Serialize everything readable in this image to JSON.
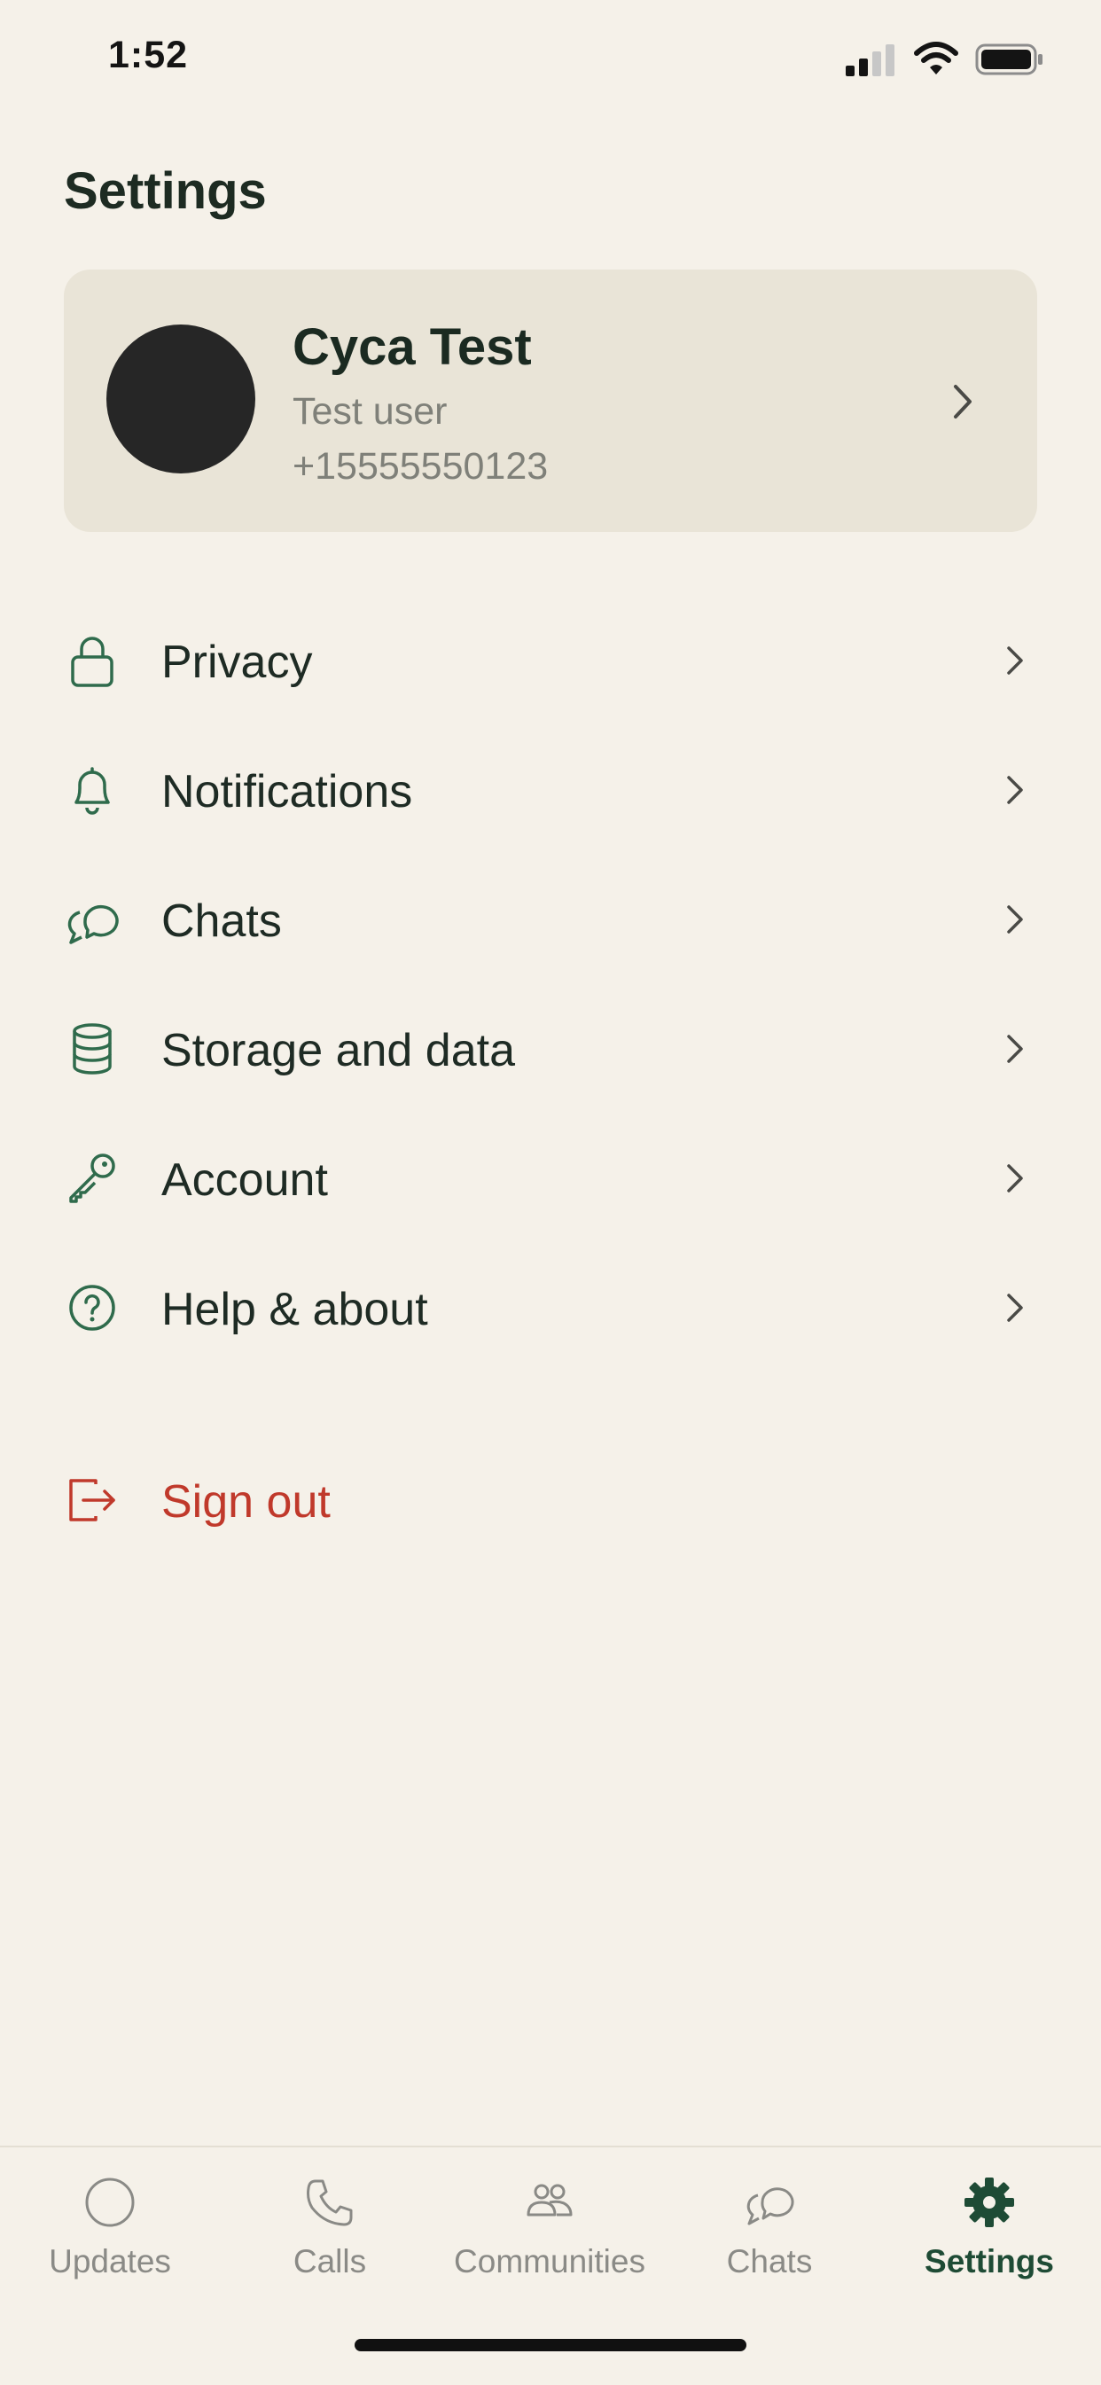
{
  "status_bar": {
    "time": "1:52"
  },
  "header": {
    "title": "Settings"
  },
  "profile": {
    "name": "Cyca Test",
    "status": "Test user",
    "phone": "+15555550123"
  },
  "settings_list": {
    "items": [
      {
        "label": "Privacy",
        "icon": "lock-icon"
      },
      {
        "label": "Notifications",
        "icon": "bell-icon"
      },
      {
        "label": "Chats",
        "icon": "chat-bubbles-icon"
      },
      {
        "label": "Storage and data",
        "icon": "database-icon"
      },
      {
        "label": "Account",
        "icon": "key-icon"
      },
      {
        "label": "Help & about",
        "icon": "help-circle-icon"
      }
    ],
    "sign_out": {
      "label": "Sign out",
      "icon": "sign-out-icon"
    }
  },
  "tab_bar": {
    "tabs": [
      {
        "label": "Updates",
        "icon": "updates-circle-icon",
        "active": false
      },
      {
        "label": "Calls",
        "icon": "phone-icon",
        "active": false
      },
      {
        "label": "Communities",
        "icon": "communities-icon",
        "active": false
      },
      {
        "label": "Chats",
        "icon": "chat-bubbles-icon",
        "active": false
      },
      {
        "label": "Settings",
        "icon": "gear-icon",
        "active": true
      }
    ]
  },
  "colors": {
    "background": "#f5f1e9",
    "card": "#e9e4d7",
    "icon_green": "#2f6b4c",
    "active_tab": "#1e4b35",
    "danger": "#c0392b",
    "muted_text": "#7f8079"
  }
}
